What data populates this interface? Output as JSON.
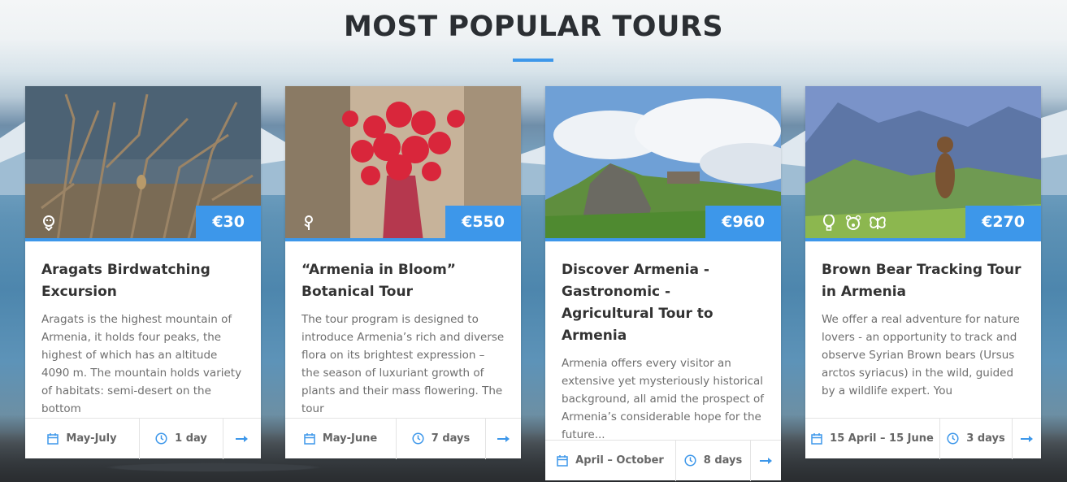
{
  "section": {
    "title": "MOST POPULAR TOURS"
  },
  "colors": {
    "accent": "#3d97ea",
    "title_text": "#2b2f33",
    "body_text": "#6e6e6e"
  },
  "tours": [
    {
      "title": "Aragats Birdwatching Excursion",
      "price": "€30",
      "category_icons": [
        "bird-icon"
      ],
      "description": "Aragats is the highest mountain of Armenia, it holds four peaks, the highest of which has an altitude 4090 m. The mountain holds variety of habitats: semi-desert on the bottom",
      "dates": "May-July",
      "duration": "1 day"
    },
    {
      "title": "“Armenia in Bloom” Botanical Tour",
      "price": "€550",
      "category_icons": [
        "flower-icon"
      ],
      "description": "The tour program is designed to introduce Armenia’s rich and diverse flora on its brightest expression – the season of luxuriant growth of plants and their mass flowering. The tour",
      "dates": "May-June",
      "duration": "7 days"
    },
    {
      "title": "Discover Armenia - Gastronomic - Agricultural Tour to Armenia",
      "price": "€960",
      "category_icons": [],
      "description": "Armenia offers every visitor an extensive yet mysteriously historical background, all amid the prospect of Armenia’s considerable hope for the future...",
      "dates": "April – October",
      "duration": "8 days"
    },
    {
      "title": "Brown Bear Tracking Tour in Armenia",
      "price": "€270",
      "category_icons": [
        "balloon-icon",
        "bear-icon",
        "butterfly-icon"
      ],
      "description": "We offer a real adventure for nature lovers - an opportunity to track and observe Syrian Brown bears (Ursus arctos syriacus) in the wild, guided by a wildlife expert. You",
      "dates": "15 April – 15 June",
      "duration": "3 days"
    }
  ]
}
